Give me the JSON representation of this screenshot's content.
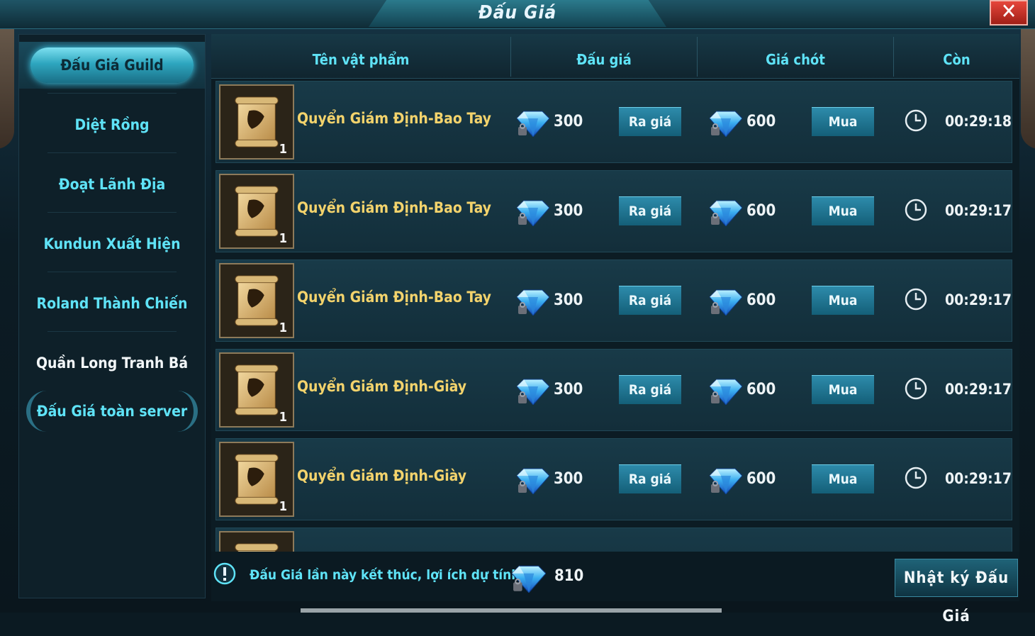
{
  "window": {
    "title": "Đấu Giá",
    "close_icon": "✕"
  },
  "sidebar": {
    "items": [
      {
        "label": "Đấu Giá Guild",
        "state": "active"
      },
      {
        "label": "Diệt Rồng"
      },
      {
        "label": "Đoạt Lãnh Địa"
      },
      {
        "label": "Kundun Xuất Hiện"
      },
      {
        "label": "Roland Thành Chiến"
      },
      {
        "label": "Quần Long Tranh Bá"
      },
      {
        "label": "Đấu Giá toàn server",
        "state": "highlight"
      }
    ]
  },
  "table": {
    "headers": [
      "Tên vật phẩm",
      "Đấu giá",
      "Giá chót",
      "Còn"
    ],
    "bid_button_label": "Ra giá",
    "buy_button_label": "Mua",
    "rows": [
      {
        "item_name": "Quyển Giám Định-Bao Tay",
        "qty": "1",
        "bid_price": "300",
        "buyout_price": "600",
        "time_left": "00:29:18",
        "icon": "glove-scroll-icon"
      },
      {
        "item_name": "Quyển Giám Định-Bao Tay",
        "qty": "1",
        "bid_price": "300",
        "buyout_price": "600",
        "time_left": "00:29:17",
        "icon": "glove-scroll-icon"
      },
      {
        "item_name": "Quyển Giám Định-Bao Tay",
        "qty": "1",
        "bid_price": "300",
        "buyout_price": "600",
        "time_left": "00:29:17",
        "icon": "glove-scroll-icon"
      },
      {
        "item_name": "Quyển Giám Định-Giày",
        "qty": "1",
        "bid_price": "300",
        "buyout_price": "600",
        "time_left": "00:29:17",
        "icon": "boots-scroll-icon"
      },
      {
        "item_name": "Quyển Giám Định-Giày",
        "qty": "1",
        "bid_price": "300",
        "buyout_price": "600",
        "time_left": "00:29:17",
        "icon": "boots-scroll-icon"
      },
      {
        "item_name": "",
        "qty": "",
        "bid_price": "",
        "buyout_price": "",
        "time_left": "",
        "icon": "scroll-icon"
      }
    ]
  },
  "footer": {
    "info_text": "Đấu Giá lần này kết thúc, lợi ích dự tính",
    "total_value": "810",
    "log_button_label": "Nhật ký Đấu Giá"
  },
  "colors": {
    "accent_cyan": "#5fe3f7",
    "item_gold": "#f3d36c",
    "close_red": "#d23a2f"
  }
}
